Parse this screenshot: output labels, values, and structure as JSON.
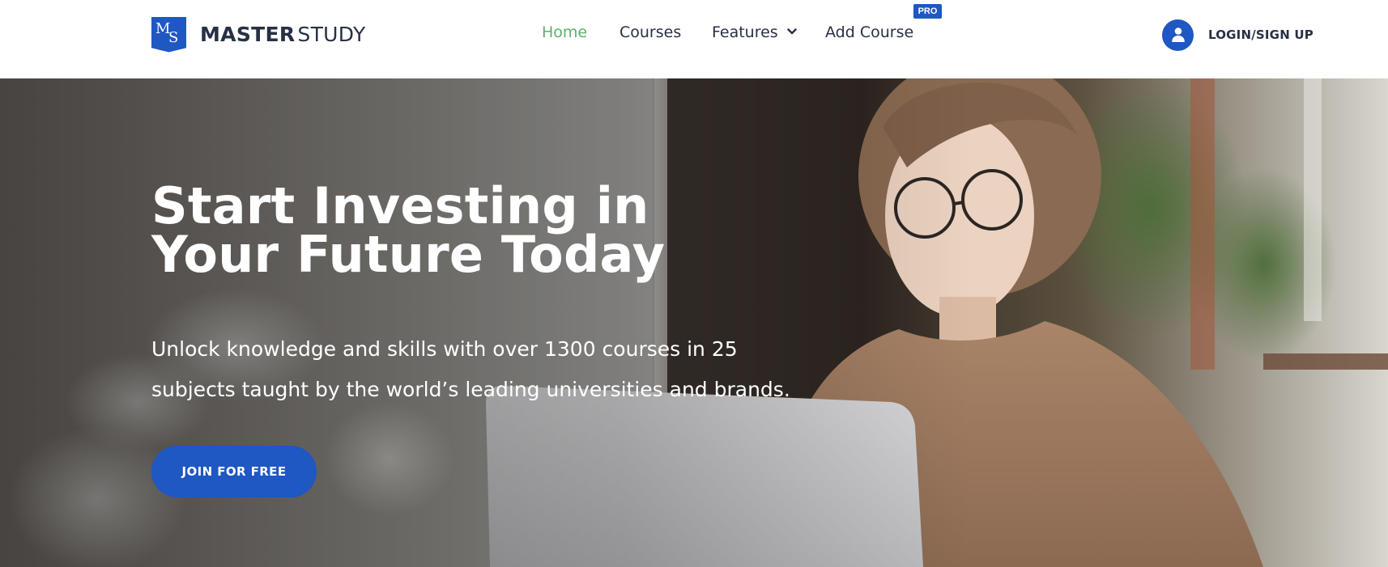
{
  "brand": {
    "badge_m": "M",
    "badge_s": "S",
    "name_bold": "MASTER",
    "name_light": "STUDY",
    "color": "#1f57c3"
  },
  "nav": {
    "home": "Home",
    "courses": "Courses",
    "features": "Features",
    "add_course": "Add Course",
    "pro_badge": "PRO",
    "active_color": "#5ab26b"
  },
  "account": {
    "login_label": "LOGIN/SIGN UP",
    "icon": "user-icon"
  },
  "hero": {
    "title_line1": "Start Investing in",
    "title_line2": "Your Future Today",
    "subtitle_line1": "Unlock knowledge and skills with over 1300 courses in 25",
    "subtitle_line2": "subjects taught by the world’s leading universities and brands.",
    "cta_label": "JOIN FOR FREE"
  }
}
